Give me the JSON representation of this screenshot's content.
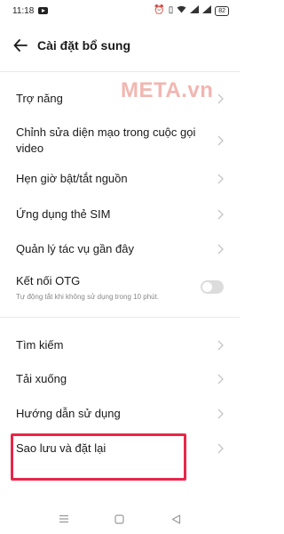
{
  "status_bar": {
    "time": "11:18",
    "battery": "82"
  },
  "header": {
    "title": "Cài đặt bổ sung"
  },
  "watermark": "META.vn",
  "items": [
    {
      "label": "Trợ năng"
    },
    {
      "label": "Chỉnh sửa diện mạo trong cuộc gọi video"
    },
    {
      "label": "Hẹn giờ bật/tắt nguồn"
    },
    {
      "label": "Ứng dụng thẻ SIM"
    },
    {
      "label": "Quản lý tác vụ gần đây"
    },
    {
      "label": "Kết nối OTG",
      "sub": "Tự động tắt khi không sử dụng trong 10 phút.",
      "toggle_on": false
    },
    {
      "label": "Tìm kiếm"
    },
    {
      "label": "Tải xuống"
    },
    {
      "label": "Hướng dẫn sử dụng"
    },
    {
      "label": "Sao lưu và đặt lại"
    }
  ],
  "colors": {
    "highlight": "#e8264a",
    "watermark": "#f2b6b0"
  }
}
